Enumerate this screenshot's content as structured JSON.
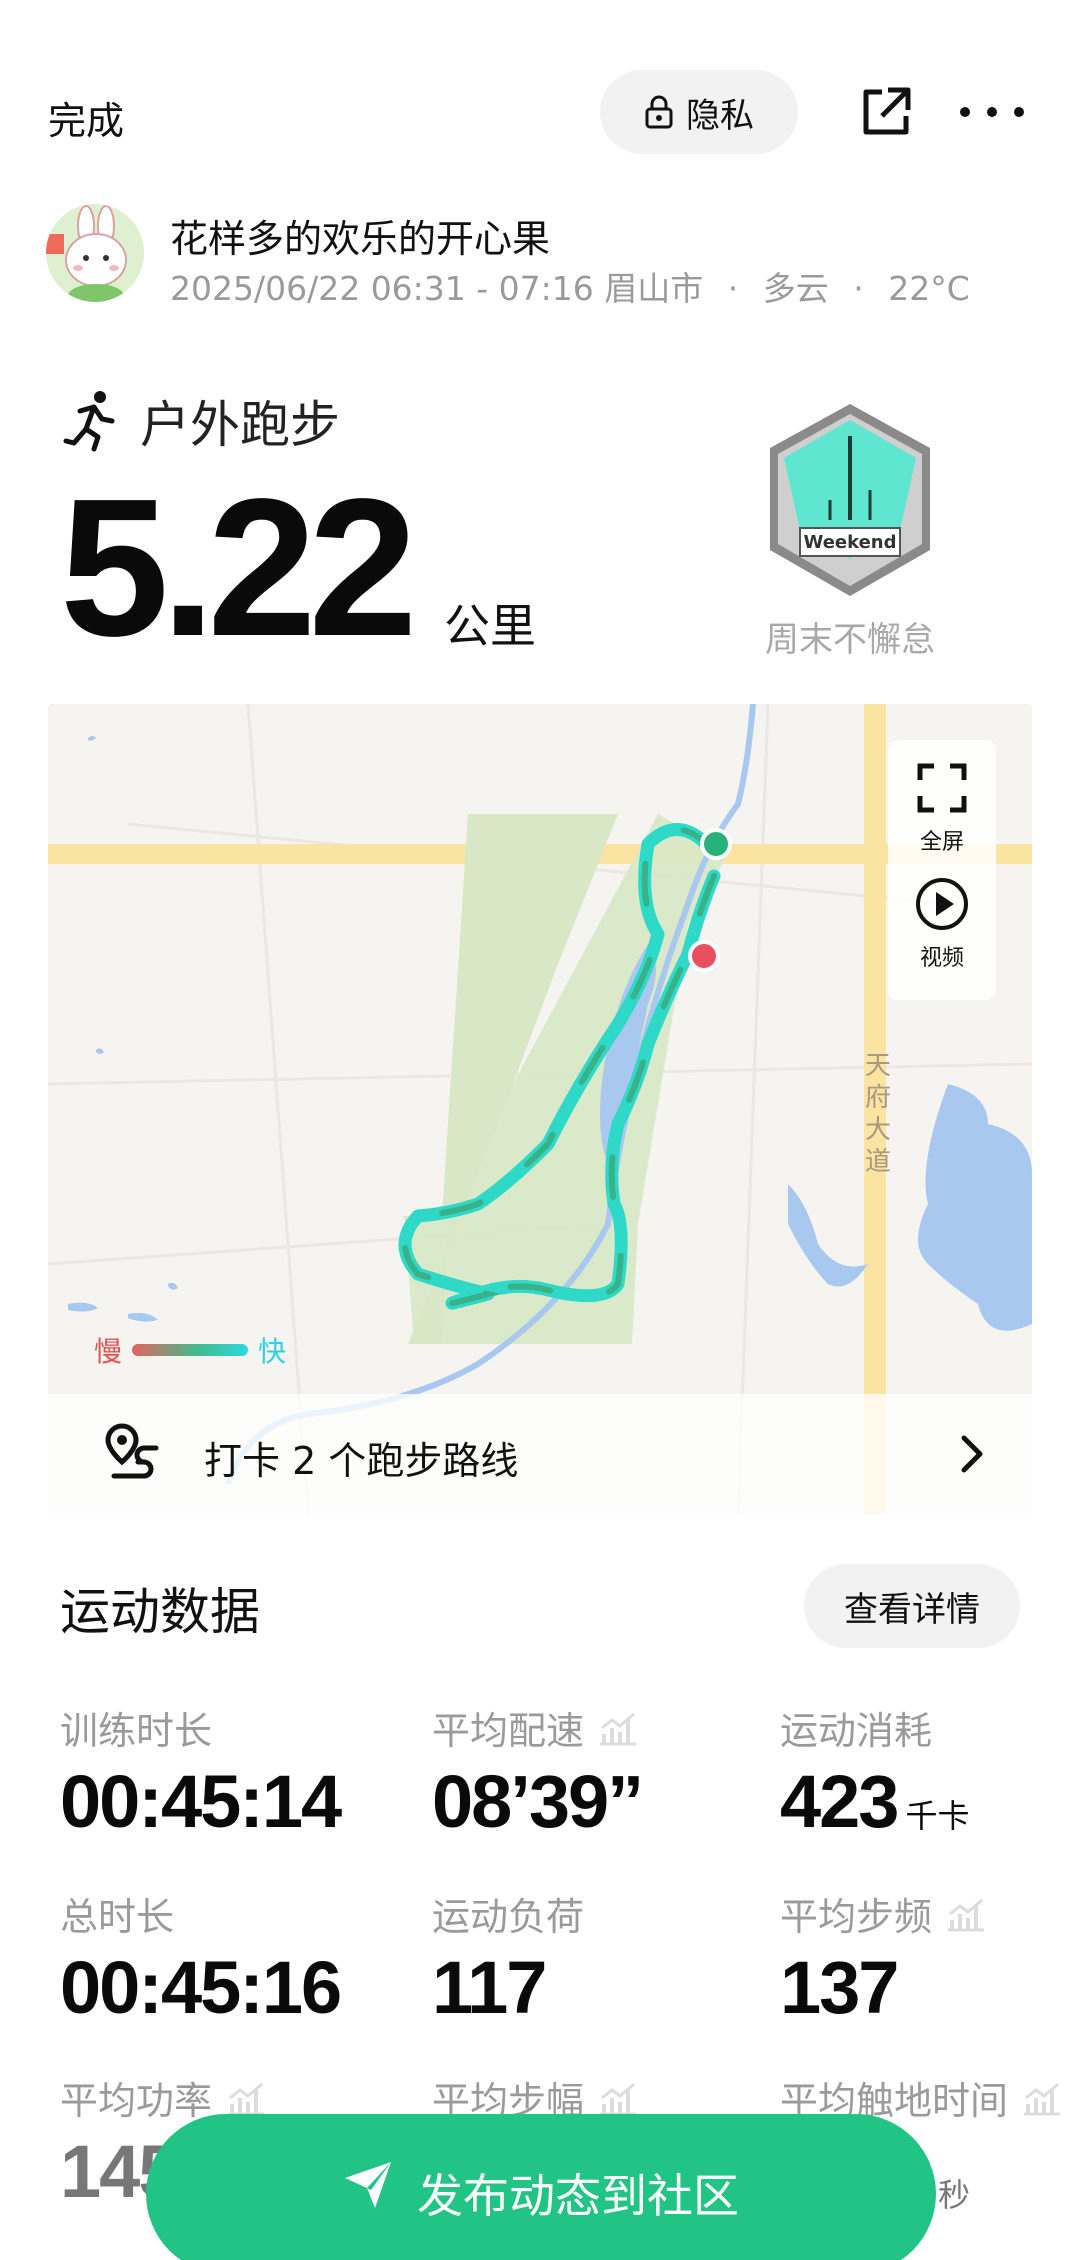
{
  "topbar": {
    "done_label": "完成",
    "privacy_label": "隐私"
  },
  "user": {
    "name": "花样多的欢乐的开心果",
    "time_range": "2025/06/22 06:31 - 07:16",
    "location": "眉山市",
    "weather": "多云",
    "temperature": "22°C",
    "separator": "·"
  },
  "workout": {
    "type": "户外跑步",
    "distance": "5.22",
    "distance_unit": "公里",
    "badge_text": "Weekend",
    "badge_name": "周末不懈怠"
  },
  "map": {
    "fullscreen_label": "全屏",
    "video_label": "视频",
    "road_label": "天府大道",
    "legend_slow": "慢",
    "legend_fast": "快",
    "route_checkin": "打卡 2 个跑步路线"
  },
  "stats": {
    "title": "运动数据",
    "detail_button": "查看详情",
    "items": [
      {
        "label": "训练时长",
        "value": "00:45:14",
        "unit": ""
      },
      {
        "label": "平均配速",
        "value": "08’39”",
        "unit": ""
      },
      {
        "label": "运动消耗",
        "value": "423",
        "unit": "千卡"
      },
      {
        "label": "总时长",
        "value": "00:45:16",
        "unit": ""
      },
      {
        "label": "运动负荷",
        "value": "117",
        "unit": ""
      },
      {
        "label": "平均步频",
        "value": "137",
        "unit": ""
      },
      {
        "label": "平均功率",
        "value": "145",
        "unit": ""
      },
      {
        "label": "平均步幅",
        "value": "",
        "unit": ""
      },
      {
        "label": "平均触地时间",
        "value": "",
        "unit": "秒"
      }
    ]
  },
  "publish": {
    "label": "发布动态到社区"
  },
  "colors": {
    "accent": "#22c486",
    "track_start": "#27b27a",
    "track_end": "#ea4f5e",
    "water": "#a9c8f0",
    "road": "#fbe3a2"
  },
  "icons": {
    "lock": "lock-icon",
    "share": "share-icon",
    "more": "more-icon",
    "runner": "runner-icon",
    "fullscreen": "fullscreen-icon",
    "play": "play-icon",
    "route": "route-icon",
    "chevron": "chevron-right-icon",
    "send": "send-icon",
    "chart": "chart-icon"
  }
}
